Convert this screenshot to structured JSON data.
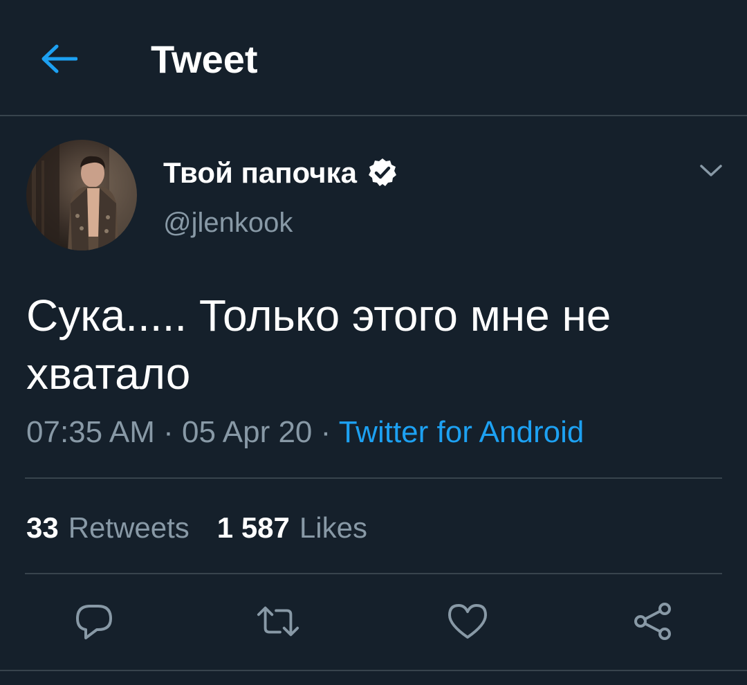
{
  "header": {
    "title": "Tweet",
    "back_icon": "arrow-left-icon"
  },
  "colors": {
    "background": "#15202b",
    "accent": "#1da1f2",
    "secondary_text": "#8899a6",
    "divider": "#38444d"
  },
  "author": {
    "name": "Твой папочка",
    "handle": "@jlenkook",
    "verified": true
  },
  "tweet": {
    "text": "Сука..... Только этого мне не хватало",
    "time": "07:35 AM",
    "date": "05 Apr 20",
    "separator": "·",
    "source": "Twitter for Android"
  },
  "stats": {
    "retweets_count": "33",
    "retweets_label": "Retweets",
    "likes_count": "1 587",
    "likes_label": "Likes"
  },
  "actions": {
    "reply_icon": "reply-icon",
    "retweet_icon": "retweet-icon",
    "like_icon": "heart-icon",
    "share_icon": "share-icon"
  }
}
